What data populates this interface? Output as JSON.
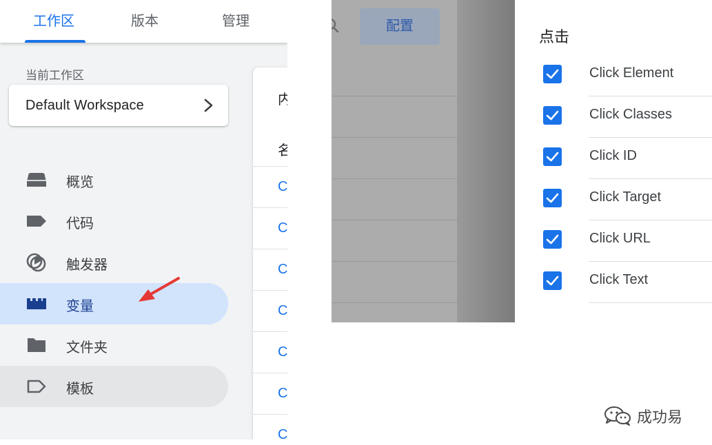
{
  "top_tabs": [
    {
      "label": "工作区",
      "active": true
    },
    {
      "label": "版本",
      "active": false
    },
    {
      "label": "管理",
      "active": false
    }
  ],
  "sidebar": {
    "workspace_label": "当前工作区",
    "workspace_name": "Default Workspace",
    "items": [
      {
        "label": "概览",
        "icon": "overview-icon"
      },
      {
        "label": "代码",
        "icon": "tag-icon"
      },
      {
        "label": "触发器",
        "icon": "trigger-icon"
      },
      {
        "label": "变量",
        "icon": "variables-icon",
        "active": true
      },
      {
        "label": "文件夹",
        "icon": "folder-icon"
      },
      {
        "label": "模板",
        "icon": "template-icon"
      }
    ]
  },
  "content_card": {
    "header_text": "内",
    "column_text": "名",
    "links": [
      "C",
      "C",
      "C",
      "C",
      "C",
      "C",
      "C"
    ]
  },
  "middle": {
    "config_button": "配置"
  },
  "click_panel": {
    "title": "点击",
    "items": [
      {
        "label": "Click Element",
        "checked": true
      },
      {
        "label": "Click Classes",
        "checked": true
      },
      {
        "label": "Click ID",
        "checked": true
      },
      {
        "label": "Click Target",
        "checked": true
      },
      {
        "label": "Click URL",
        "checked": true
      },
      {
        "label": "Click Text",
        "checked": true
      }
    ]
  },
  "watermark": {
    "text": "成功易"
  },
  "colors": {
    "accent": "#1a73e8",
    "active_nav_bg": "#d2e3fc",
    "arrow": "#e53935"
  }
}
